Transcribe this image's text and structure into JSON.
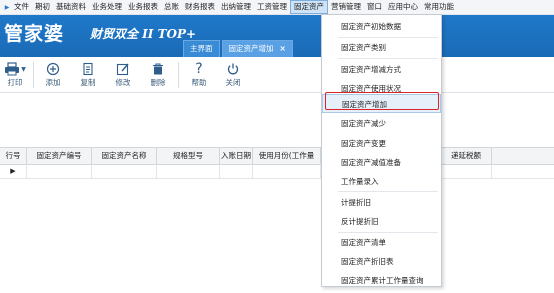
{
  "menubar": {
    "items": [
      "文件",
      "期初",
      "基础资料",
      "业务处理",
      "业务报表",
      "总账",
      "财务报表",
      "出纳管理",
      "工资管理",
      "固定资产",
      "营销管理",
      "窗口",
      "应用中心",
      "常用功能"
    ],
    "active_index": 9
  },
  "banner": {
    "logo_main": "管家婆",
    "logo_sub": "财贸双全 II TOP+",
    "tabs": [
      {
        "label": "主界面"
      },
      {
        "label": "固定资产增加",
        "close": "×"
      }
    ]
  },
  "toolbar": {
    "print": "打印",
    "add": "添加",
    "copy": "复制",
    "edit": "修改",
    "delete": "删除",
    "help": "帮助",
    "close": "关闭"
  },
  "grid": {
    "columns": [
      "行号",
      "固定资产编号",
      "固定资产名称",
      "规格型号",
      "入账日期",
      "使用月份(工作量",
      "",
      "",
      "",
      "",
      "递延税额"
    ],
    "row_marker": "▶"
  },
  "dropdown": {
    "items": [
      "固定资产初始数据",
      "固定资产类别",
      "固定资产增减方式",
      "固定资产使用状况",
      "固定资产增加",
      "固定资产减少",
      "固定资产变更",
      "固定资产减值准备",
      "工作量录入",
      "计提折旧",
      "反计提折旧",
      "固定资产清单",
      "固定资产折旧表",
      "固定资产累计工作量查询"
    ],
    "highlight_index": 4
  },
  "colors": {
    "banner": "#1f78c9",
    "highlight_border": "#d9242a",
    "active_menu_bg": "#cfe3f7"
  }
}
